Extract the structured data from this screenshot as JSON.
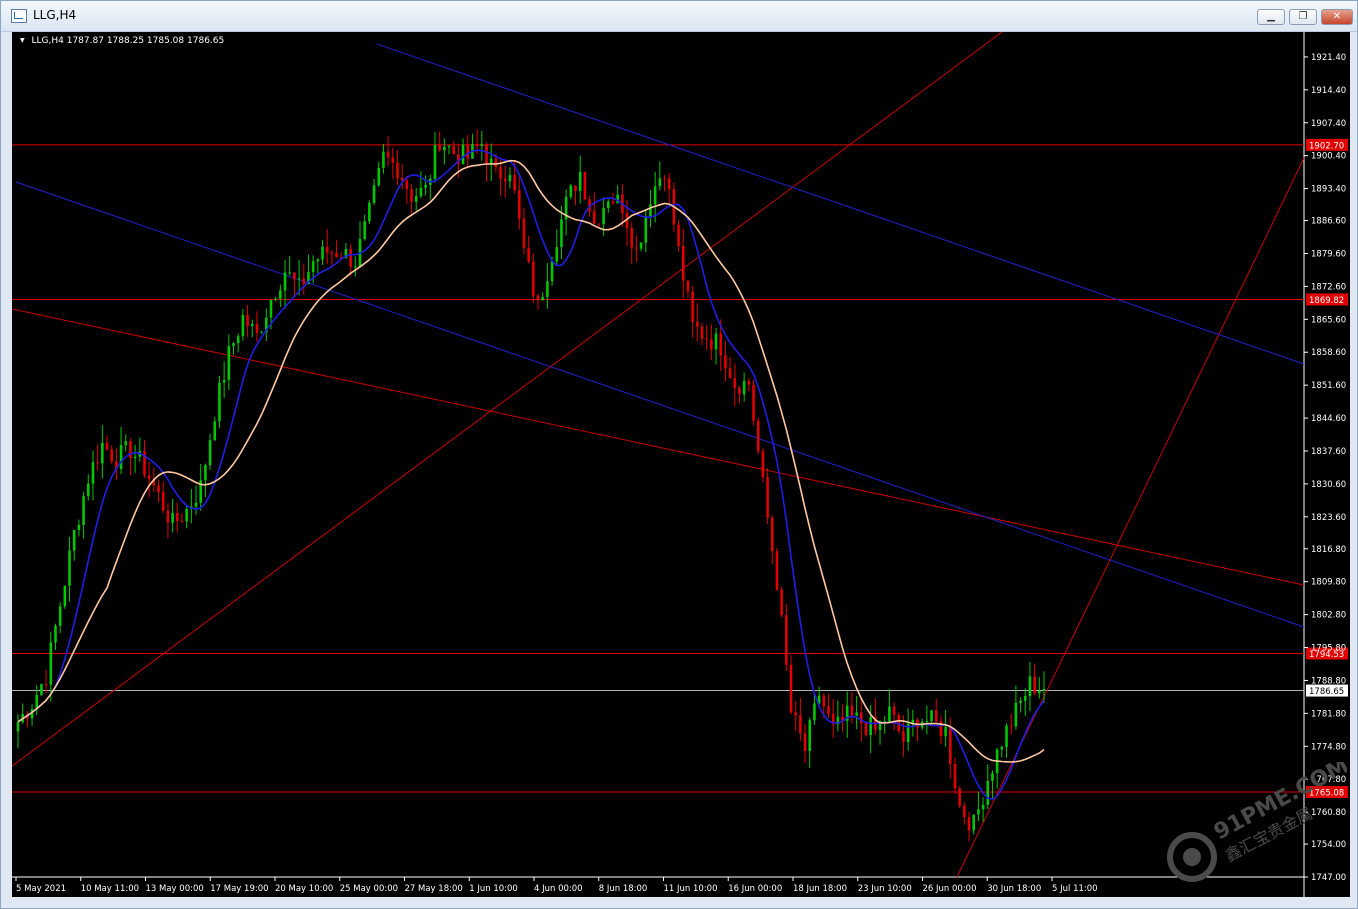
{
  "window": {
    "title": "LLG,H4",
    "buttons": {
      "minimize": "▁",
      "restore": "❐",
      "close": "✕"
    }
  },
  "header": {
    "symbol": "LLG,H4",
    "open": "1787.87",
    "high": "1788.25",
    "low": "1785.08",
    "close": "1786.65"
  },
  "watermark": {
    "text": "91PME.COM",
    "chinese": "鑫汇宝贵金属"
  },
  "colors": {
    "background": "#000000",
    "bull": "#00c800",
    "bear": "#e00000",
    "ma_fast": "#1e1ee6",
    "ma_slow": "#ffc8a0",
    "hline": "#e00000",
    "trend_red": "#c80000",
    "trend_blue": "#2020d0",
    "current_price_line": "#b4b4b4",
    "text": "#ffffff"
  },
  "chart_data": {
    "type": "candlestick",
    "symbol": "LLG",
    "timeframe": "H4",
    "ylim": [
      1747.0,
      1925.0
    ],
    "y_ticks": [
      "1921.40",
      "1914.40",
      "1907.40",
      "1900.40",
      "1893.40",
      "1886.60",
      "1879.60",
      "1872.60",
      "1865.60",
      "1858.60",
      "1851.60",
      "1844.60",
      "1837.60",
      "1830.60",
      "1823.60",
      "1816.80",
      "1809.80",
      "1802.80",
      "1795.80",
      "1788.80",
      "1781.80",
      "1774.80",
      "1767.80",
      "1760.80",
      "1754.00",
      "1747.00"
    ],
    "x_ticks": [
      "5 May 2021",
      "10 May 11:00",
      "13 May 00:00",
      "17 May 19:00",
      "20 May 10:00",
      "25 May 00:00",
      "27 May 18:00",
      "1 Jun 10:00",
      "4 Jun 00:00",
      "8 Jun 18:00",
      "11 Jun 10:00",
      "16 Jun 00:00",
      "18 Jun 18:00",
      "23 Jun 10:00",
      "26 Jun 00:00",
      "30 Jun 18:00",
      "5 Jul 11:00"
    ],
    "horizontal_lines": [
      {
        "price": 1902.7,
        "label": "1902.70"
      },
      {
        "price": 1869.82,
        "label": "1869.82"
      },
      {
        "price": 1794.53,
        "label": "1794.53"
      },
      {
        "price": 1765.08,
        "label": "1765.08"
      }
    ],
    "current_price": {
      "price": 1786.65,
      "label": "1786.65"
    },
    "close_path": [
      [
        0,
        1780
      ],
      [
        3,
        1784
      ],
      [
        6,
        1790
      ],
      [
        9,
        1805
      ],
      [
        12,
        1820
      ],
      [
        15,
        1832
      ],
      [
        18,
        1839
      ],
      [
        21,
        1836
      ],
      [
        24,
        1838
      ],
      [
        27,
        1834
      ],
      [
        30,
        1828
      ],
      [
        33,
        1822
      ],
      [
        36,
        1825
      ],
      [
        39,
        1830
      ],
      [
        42,
        1846
      ],
      [
        45,
        1858
      ],
      [
        48,
        1866
      ],
      [
        51,
        1862
      ],
      [
        54,
        1870
      ],
      [
        57,
        1876
      ],
      [
        60,
        1872
      ],
      [
        63,
        1878
      ],
      [
        66,
        1880
      ],
      [
        69,
        1880
      ],
      [
        72,
        1878
      ],
      [
        75,
        1888
      ],
      [
        78,
        1900
      ],
      [
        81,
        1898
      ],
      [
        84,
        1892
      ],
      [
        87,
        1893
      ],
      [
        90,
        1904
      ],
      [
        93,
        1901
      ],
      [
        96,
        1900
      ],
      [
        99,
        1903
      ],
      [
        102,
        1896
      ],
      [
        105,
        1898
      ],
      [
        108,
        1880
      ],
      [
        111,
        1868
      ],
      [
        114,
        1880
      ],
      [
        117,
        1890
      ],
      [
        120,
        1897
      ],
      [
        123,
        1886
      ],
      [
        126,
        1892
      ],
      [
        129,
        1890
      ],
      [
        132,
        1880
      ],
      [
        135,
        1892
      ],
      [
        138,
        1898
      ],
      [
        141,
        1880
      ],
      [
        144,
        1864
      ],
      [
        147,
        1862
      ],
      [
        150,
        1860
      ],
      [
        153,
        1852
      ],
      [
        156,
        1852
      ],
      [
        159,
        1830
      ],
      [
        162,
        1810
      ],
      [
        165,
        1782
      ],
      [
        168,
        1774
      ],
      [
        171,
        1786
      ],
      [
        174,
        1778
      ],
      [
        177,
        1781
      ],
      [
        180,
        1780
      ],
      [
        183,
        1778
      ],
      [
        186,
        1782
      ],
      [
        189,
        1776
      ],
      [
        192,
        1781
      ],
      [
        195,
        1780
      ],
      [
        198,
        1778
      ],
      [
        201,
        1762
      ],
      [
        204,
        1758
      ],
      [
        207,
        1768
      ],
      [
        210,
        1776
      ],
      [
        213,
        1782
      ],
      [
        216,
        1788
      ],
      [
        219,
        1787
      ]
    ],
    "ma_fast_period": 9,
    "ma_slow_period": 20
  }
}
